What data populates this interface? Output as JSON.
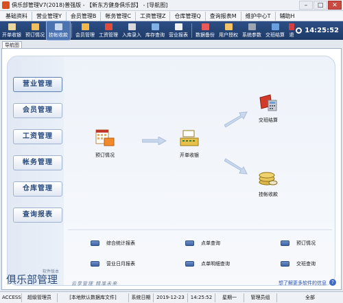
{
  "window": {
    "title": "俱乐部管理V7(2018)普强版 - 【新东方健身俱乐部】 - [导航图]",
    "minimize": "–",
    "maximize": "□",
    "close": "✕"
  },
  "menu": [
    "基础资料",
    "营业管理Y",
    "会员管理B",
    "帐务管理C",
    "工资管理Z",
    "仓库管理Q",
    "查询报表M",
    "维护中心T",
    "辅助H"
  ],
  "toolbar": {
    "buttons": [
      {
        "label": "开单收银",
        "icon": "cash-register-icon"
      },
      {
        "label": "预订情况",
        "icon": "booking-icon"
      },
      {
        "label": "挂帐收款",
        "icon": "credit-collection-icon"
      },
      {
        "label": "会员管理",
        "icon": "member-icon"
      },
      {
        "label": "工资管理",
        "icon": "salary-icon"
      },
      {
        "label": "入库录入",
        "icon": "stock-in-icon"
      },
      {
        "label": "库存查询",
        "icon": "inventory-query-icon"
      },
      {
        "label": "营业报表",
        "icon": "report-icon"
      },
      {
        "label": "数据备份",
        "icon": "backup-icon"
      },
      {
        "label": "用户授权",
        "icon": "user-auth-icon"
      },
      {
        "label": "系统参数",
        "icon": "settings-icon"
      },
      {
        "label": "交班结算",
        "icon": "shift-settle-icon"
      },
      {
        "label": "退",
        "icon": "exit-icon"
      }
    ],
    "active_index": 2,
    "clock": "14:25:52"
  },
  "nav_tab": "导航图",
  "sidebar": [
    "营业管理",
    "会员管理",
    "工资管理",
    "帐务管理",
    "仓库管理",
    "查询报表"
  ],
  "sidebar_active": 0,
  "flow": {
    "booking": "预订情况",
    "checkout": "开单收银",
    "shift_settle": "交班结算",
    "credit_collect": "挂帐收款"
  },
  "reports": [
    [
      "综合统计报表",
      "点单查询",
      "预订情况"
    ],
    [
      "营业日月报表",
      "点单明细查询",
      "交班查询"
    ]
  ],
  "footer": {
    "brand": "俱乐部管理",
    "brand_small": "软件版本",
    "tagline": "云享管理 精准未来",
    "help": "想了解更多软件的信息",
    "help_icon": "?"
  },
  "status": {
    "mode": "ACCESS",
    "user": "超级管理员",
    "db": "[本地默认数据库文件]",
    "date_label": "系统日期",
    "date": "2019-12-23",
    "time": "14:25:52",
    "weekday": "星期一",
    "role": "管理员组",
    "scope": "全部"
  },
  "colors": {
    "accent": "#1e3a66",
    "panel": "#eef3fa",
    "sidebar_text": "#2a4b7e"
  }
}
